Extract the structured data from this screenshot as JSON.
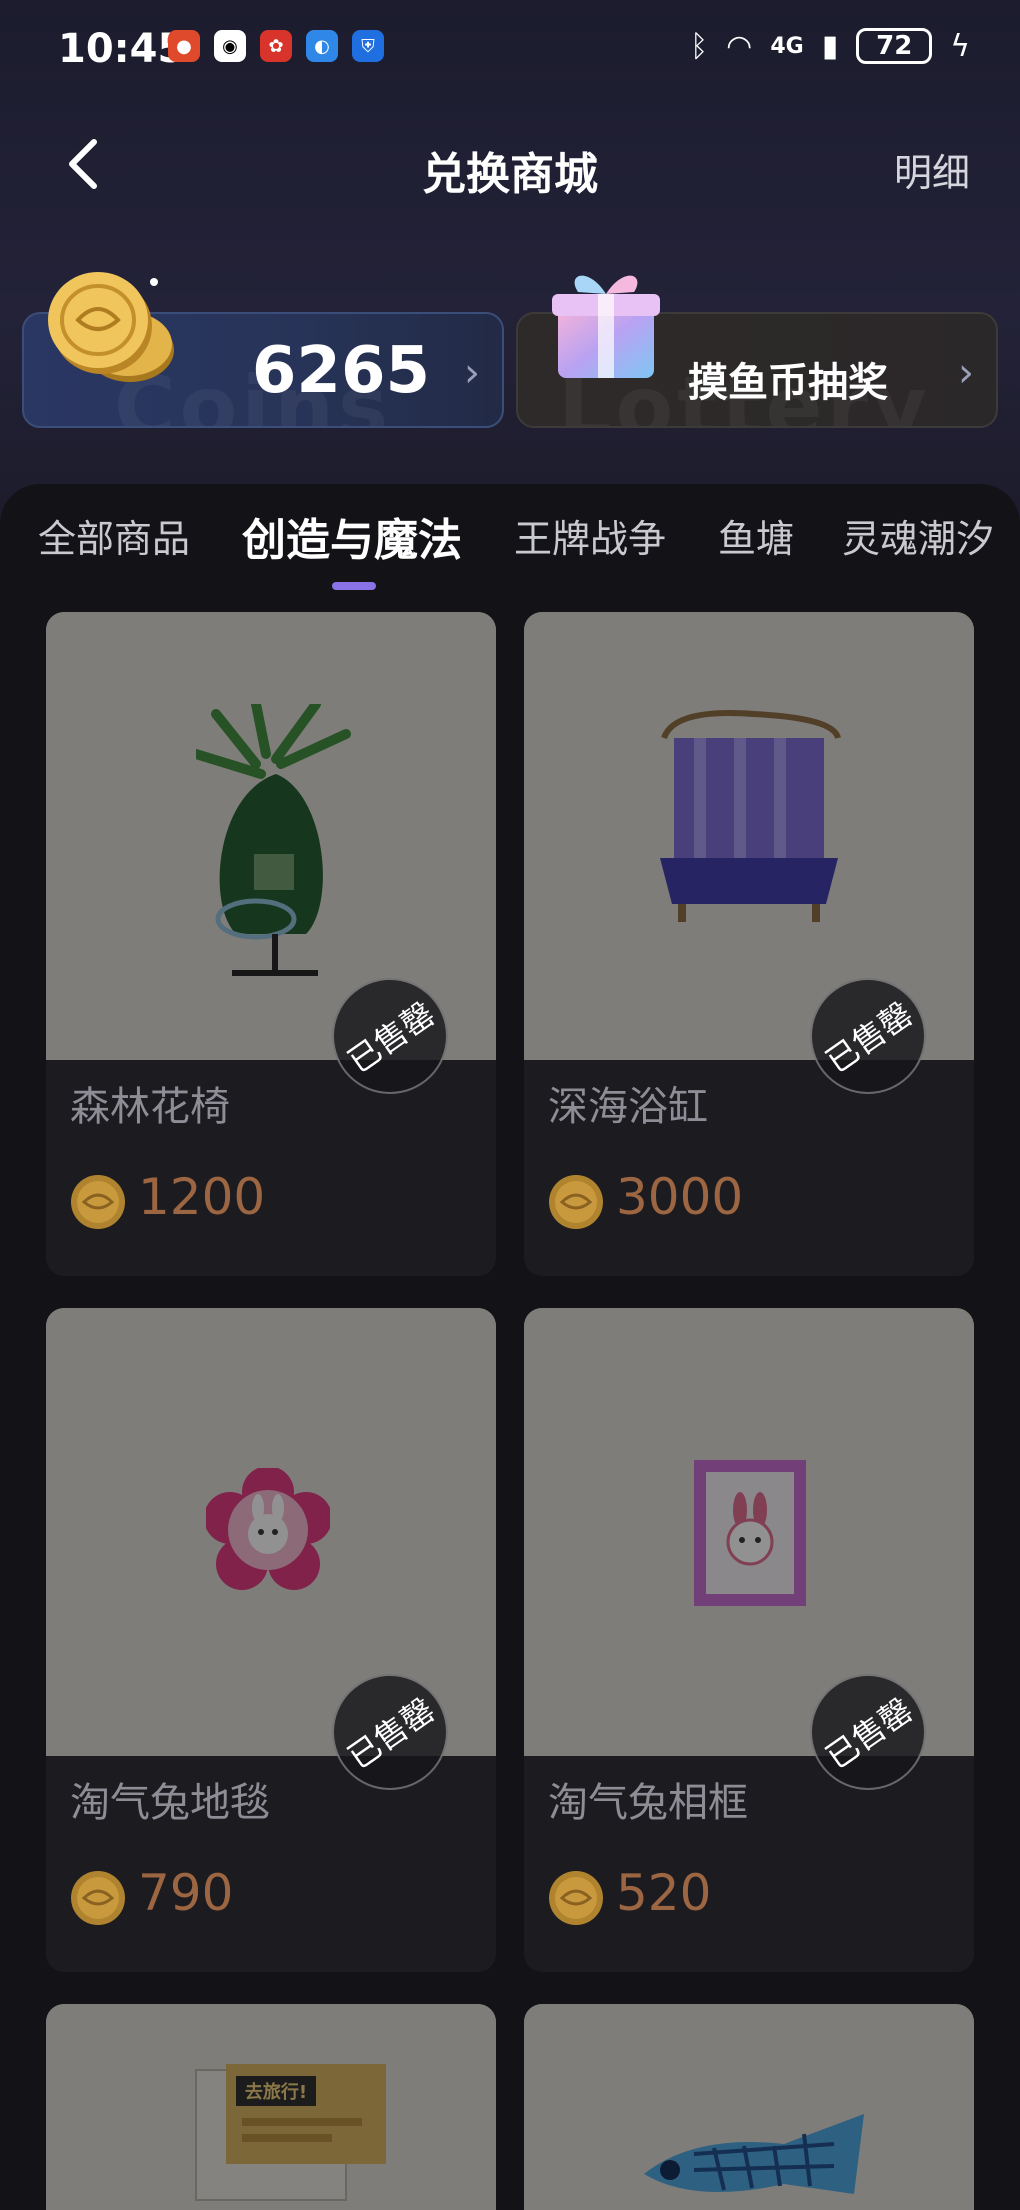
{
  "status_bar": {
    "time": "10:45",
    "network": "4G",
    "battery": "72"
  },
  "header": {
    "title": "兑换商城",
    "detail_link": "明细"
  },
  "coins_card": {
    "value": "6265",
    "watermark": "Coins"
  },
  "lottery_card": {
    "label": "摸鱼币抽奖",
    "watermark": "Lottery"
  },
  "tabs": [
    {
      "label": "全部商品",
      "active": false
    },
    {
      "label": "创造与魔法",
      "active": true
    },
    {
      "label": "王牌战争",
      "active": false
    },
    {
      "label": "鱼塘",
      "active": false
    },
    {
      "label": "灵魂潮汐",
      "active": false
    }
  ],
  "products": [
    {
      "name": "森林花椅",
      "price": "1200",
      "badge": "已售罄",
      "icon": "forest-flower-chair"
    },
    {
      "name": "深海浴缸",
      "price": "3000",
      "badge": "已售罄",
      "icon": "deep-sea-bathtub"
    },
    {
      "name": "淘气兔地毯",
      "price": "790",
      "badge": "已售罄",
      "icon": "bunny-rug"
    },
    {
      "name": "淘气兔相框",
      "price": "520",
      "badge": "已售罄",
      "icon": "bunny-photo-frame"
    },
    {
      "name": "",
      "price": "",
      "badge": "",
      "icon": "travel-ticket",
      "art_text": "去旅行!"
    },
    {
      "name": "",
      "price": "",
      "badge": "",
      "icon": "blue-koi-streamer"
    }
  ],
  "colors": {
    "accent": "#8a73e6",
    "price": "#9c6642",
    "background": "#131217"
  }
}
